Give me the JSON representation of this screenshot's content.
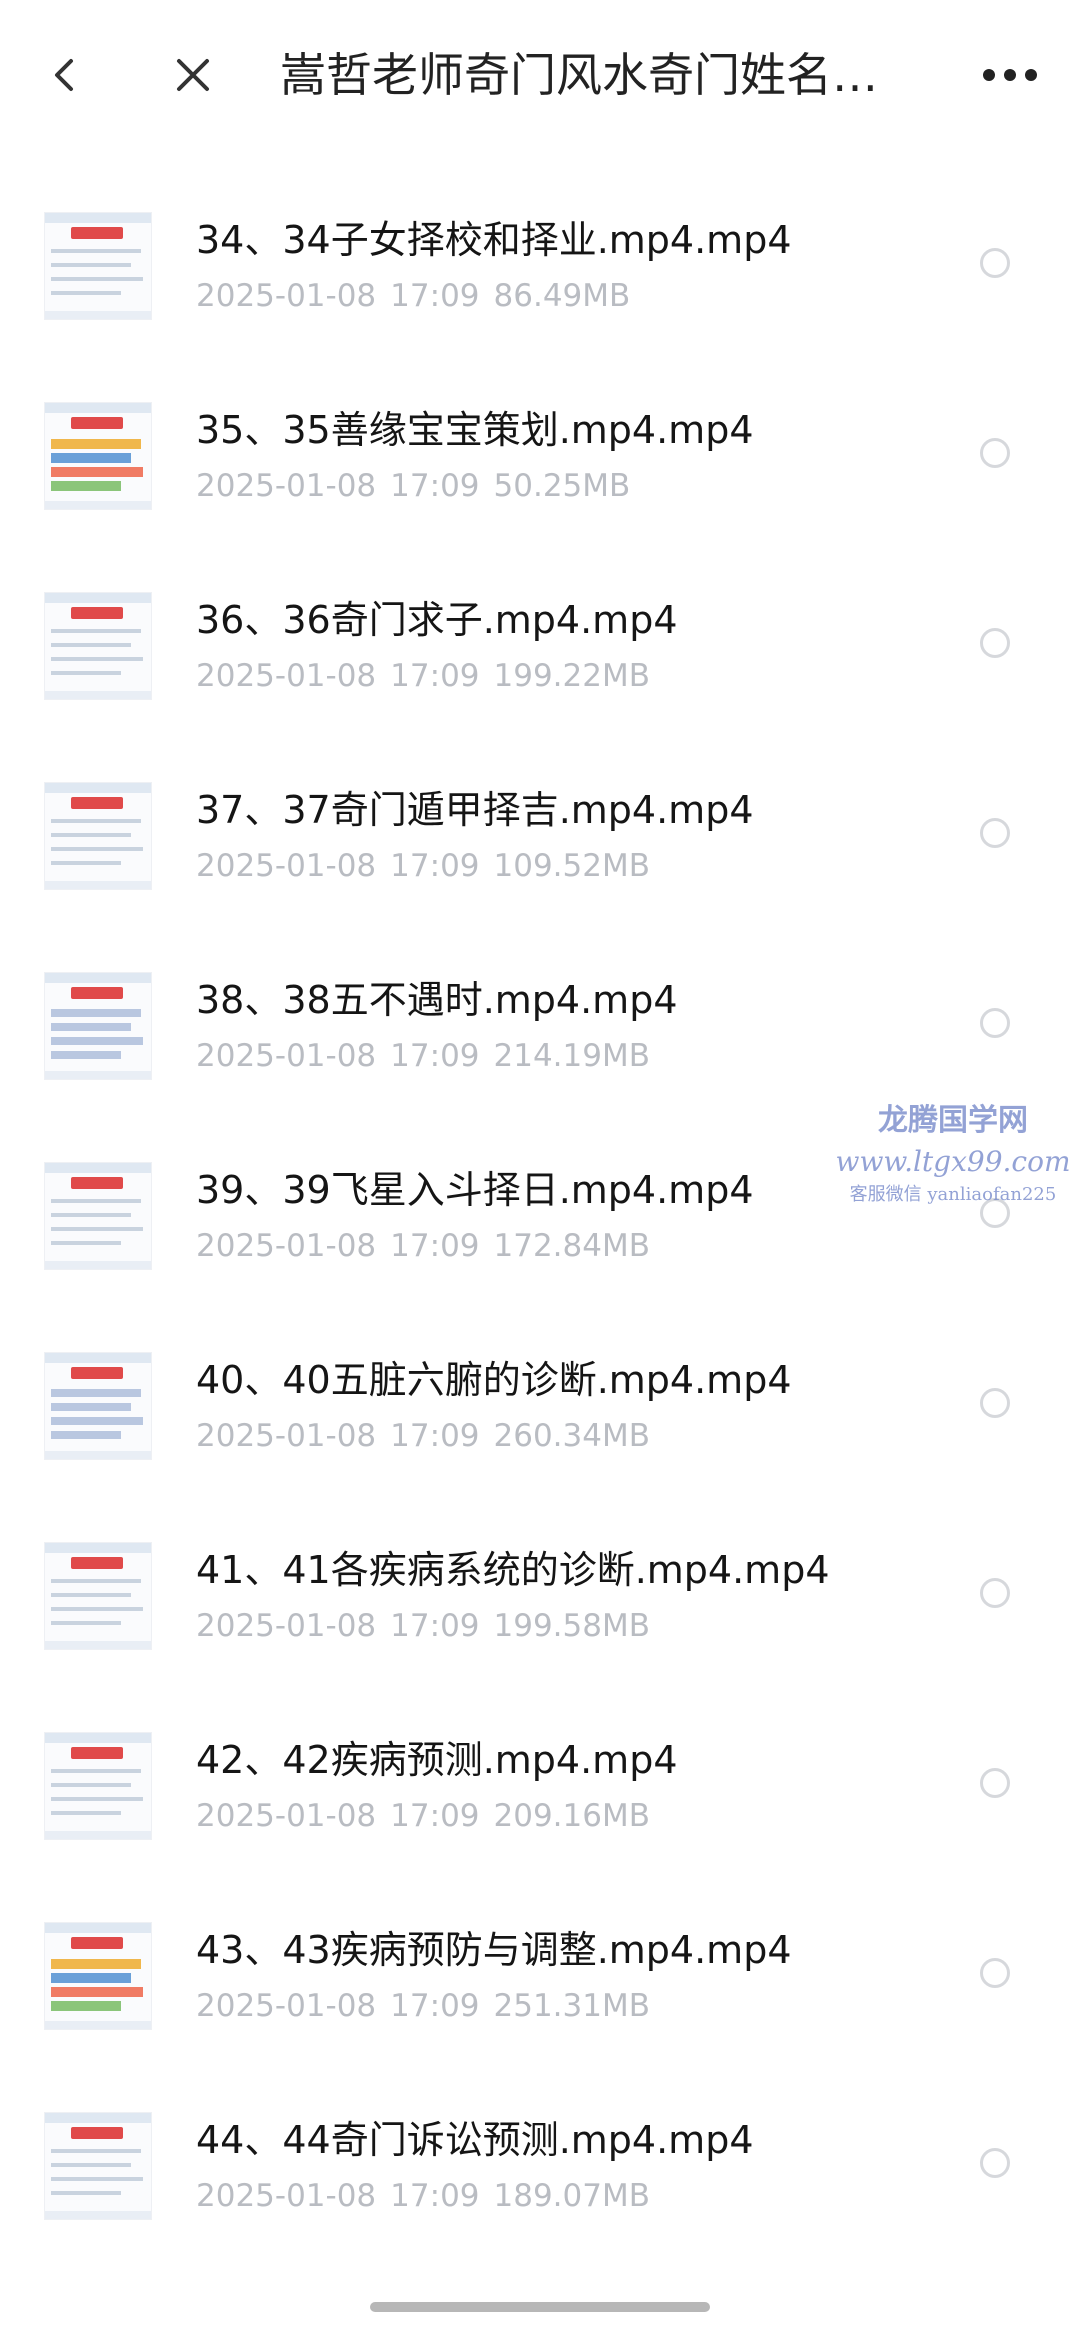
{
  "header": {
    "title": "嵩哲老师奇门风水奇门姓名学…",
    "back_icon": "chevron-left-icon",
    "close_icon": "close-icon",
    "more_icon": "more-horizontal-icon"
  },
  "files": [
    {
      "name": "34、34子女择校和择业.mp4.mp4",
      "date": "2025-01-08",
      "time": "17:09",
      "size": "86.49MB"
    },
    {
      "name": "35、35善缘宝宝策划.mp4.mp4",
      "date": "2025-01-08",
      "time": "17:09",
      "size": "50.25MB"
    },
    {
      "name": "36、36奇门求子.mp4.mp4",
      "date": "2025-01-08",
      "time": "17:09",
      "size": "199.22MB"
    },
    {
      "name": "37、37奇门遁甲择吉.mp4.mp4",
      "date": "2025-01-08",
      "time": "17:09",
      "size": "109.52MB"
    },
    {
      "name": "38、38五不遇时.mp4.mp4",
      "date": "2025-01-08",
      "time": "17:09",
      "size": "214.19MB"
    },
    {
      "name": "39、39飞星入斗择日.mp4.mp4",
      "date": "2025-01-08",
      "time": "17:09",
      "size": "172.84MB"
    },
    {
      "name": "40、40五脏六腑的诊断.mp4.mp4",
      "date": "2025-01-08",
      "time": "17:09",
      "size": "260.34MB"
    },
    {
      "name": "41、41各疾病系统的诊断.mp4.mp4",
      "date": "2025-01-08",
      "time": "17:09",
      "size": "199.58MB"
    },
    {
      "name": "42、42疾病预测.mp4.mp4",
      "date": "2025-01-08",
      "time": "17:09",
      "size": "209.16MB"
    },
    {
      "name": "43、43疾病预防与调整.mp4.mp4",
      "date": "2025-01-08",
      "time": "17:09",
      "size": "251.31MB"
    },
    {
      "name": "44、44奇门诉讼预测.mp4.mp4",
      "date": "2025-01-08",
      "time": "17:09",
      "size": "189.07MB"
    }
  ],
  "watermark": {
    "line1": "龙腾国学网",
    "line2": "www.ltgx99.com",
    "line3": "客服微信 yanliaofan225"
  },
  "colors": {
    "text_primary": "#151515",
    "text_secondary": "#b9bcc2",
    "radio_border": "#d6d8dc",
    "watermark": "#6f83c8"
  }
}
